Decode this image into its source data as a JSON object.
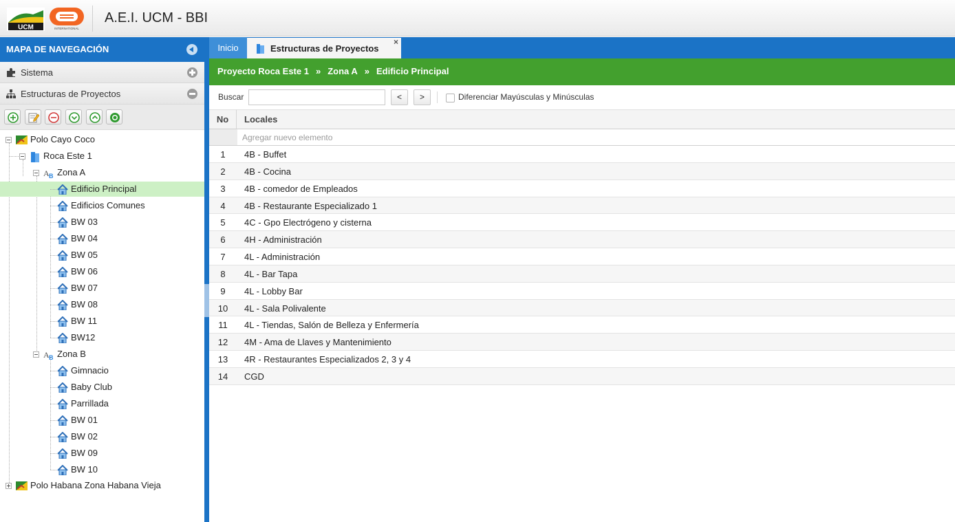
{
  "header": {
    "title": "A.E.I. UCM - BBI",
    "logo_ucm": "UCM",
    "logo_bbi": "INTERNATIONAL"
  },
  "sidebar": {
    "title": "MAPA DE NAVEGACIÓN",
    "sections": [
      {
        "label": "Sistema",
        "icon": "puzzle-icon",
        "expanded": false
      },
      {
        "label": "Estructuras de Proyectos",
        "icon": "sitemap-icon",
        "expanded": true
      }
    ],
    "toolbar": [
      "add-icon",
      "edit-icon",
      "remove-icon",
      "move-down-icon",
      "move-up-icon",
      "confirm-icon"
    ]
  },
  "tree": {
    "polos": [
      {
        "label": "Polo Cayo Coco"
      },
      {
        "label": "Polo Habana Zona Habana Vieja"
      }
    ],
    "proyecto": "Roca Este 1",
    "zona_a": {
      "label": "Zona A",
      "items": [
        "Edificio Principal",
        "Edificios Comunes",
        "BW 03",
        "BW 04",
        "BW 05",
        "BW 06",
        "BW 07",
        "BW 08",
        "BW 11",
        "BW12"
      ]
    },
    "zona_b": {
      "label": "Zona B",
      "items": [
        "Gimnacio",
        "Baby Club",
        "Parrillada",
        "BW 01",
        "BW 02",
        "BW 09",
        "BW 10"
      ]
    }
  },
  "tabs": {
    "inicio": "Inicio",
    "active": "Estructuras de Proyectos",
    "close": "×"
  },
  "breadcrumb": {
    "proyecto": "Proyecto Roca Este 1",
    "zona": "Zona A",
    "edificio": "Edificio Principal",
    "sep": "»"
  },
  "search": {
    "label": "Buscar",
    "value": "",
    "prev": "<",
    "next": ">",
    "case_label": "Diferenciar Mayúsculas y Minúsculas"
  },
  "grid": {
    "col_no": "No",
    "col_locales": "Locales",
    "add_placeholder": "Agregar nuevo elemento",
    "rows": [
      {
        "no": "1",
        "local": "4B - Buffet"
      },
      {
        "no": "2",
        "local": "4B - Cocina"
      },
      {
        "no": "3",
        "local": "4B - comedor de Empleados"
      },
      {
        "no": "4",
        "local": "4B - Restaurante Especializado 1"
      },
      {
        "no": "5",
        "local": "4C - Gpo Electrógeno y cisterna"
      },
      {
        "no": "6",
        "local": "4H - Administración"
      },
      {
        "no": "7",
        "local": "4L - Administración"
      },
      {
        "no": "8",
        "local": "4L - Bar Tapa"
      },
      {
        "no": "9",
        "local": "4L - Lobby Bar"
      },
      {
        "no": "10",
        "local": "4L - Sala Polivalente"
      },
      {
        "no": "11",
        "local": "4L - Tiendas, Salón de Belleza y Enfermería"
      },
      {
        "no": "12",
        "local": "4M - Ama de Llaves y Mantenimiento"
      },
      {
        "no": "13",
        "local": "4R - Restaurantes Especializados 2, 3 y 4"
      },
      {
        "no": "14",
        "local": "CGD"
      }
    ]
  },
  "colors": {
    "blue": "#1b73c6",
    "green": "#43a02e",
    "selected": "#cdf0c5"
  }
}
